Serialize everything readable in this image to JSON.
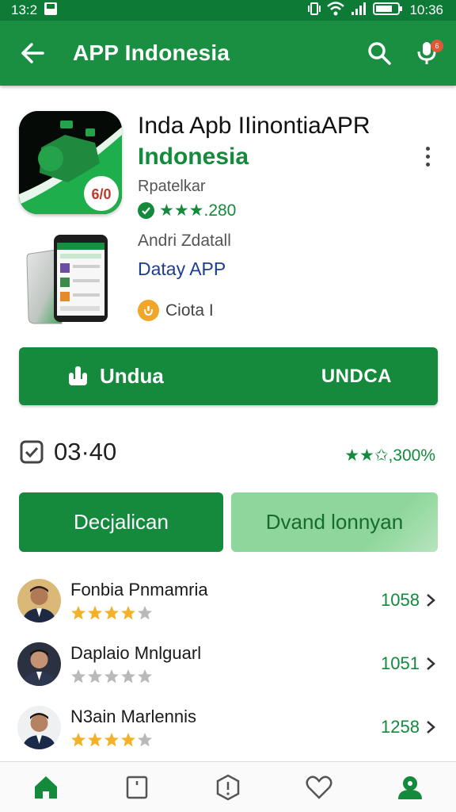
{
  "status_bar": {
    "time_left": "13:2",
    "time_right": "10:36",
    "icons": [
      "image-icon",
      "vibrate-icon",
      "wifi-icon",
      "signal-icon",
      "battery-icon"
    ]
  },
  "app_bar": {
    "title": "APP Indonesia",
    "icons": [
      "back-arrow-icon",
      "search-icon",
      "microphone-icon"
    ],
    "notification_count": "6"
  },
  "app": {
    "name": "Inda Apb IIinontiaAPR",
    "subtitle": "Indonesia",
    "developer": "Rpatelkar",
    "rating_text": "★★★.280",
    "icon_badge": "6/0",
    "detail_label": "Andri Zdatall",
    "detail_link": "Datay APP",
    "category": "Ciota I"
  },
  "download": {
    "label": "Undua",
    "right_label": "UNDCA"
  },
  "info": {
    "time": "03·40",
    "rating_summary": "★★✩,300%"
  },
  "actions": {
    "primary": "Decjalican",
    "secondary": "Dvand lonnyan"
  },
  "reviews": [
    {
      "name": "Fonbia Pnmamria",
      "stars": 4,
      "count": "1058"
    },
    {
      "name": "Daplaio Mnlguarl",
      "stars": 0,
      "count": "1051"
    },
    {
      "name": "N3ain Marlennis",
      "stars": 4,
      "count": "1258"
    }
  ],
  "bottom_nav": [
    "home-icon",
    "square-icon",
    "info-icon",
    "heart-icon",
    "profile-icon"
  ],
  "colors": {
    "primary_green": "#158a3d",
    "status_green": "#0d7a36",
    "light_green": "#8ed69b",
    "star_gold": "#f2b22c"
  }
}
